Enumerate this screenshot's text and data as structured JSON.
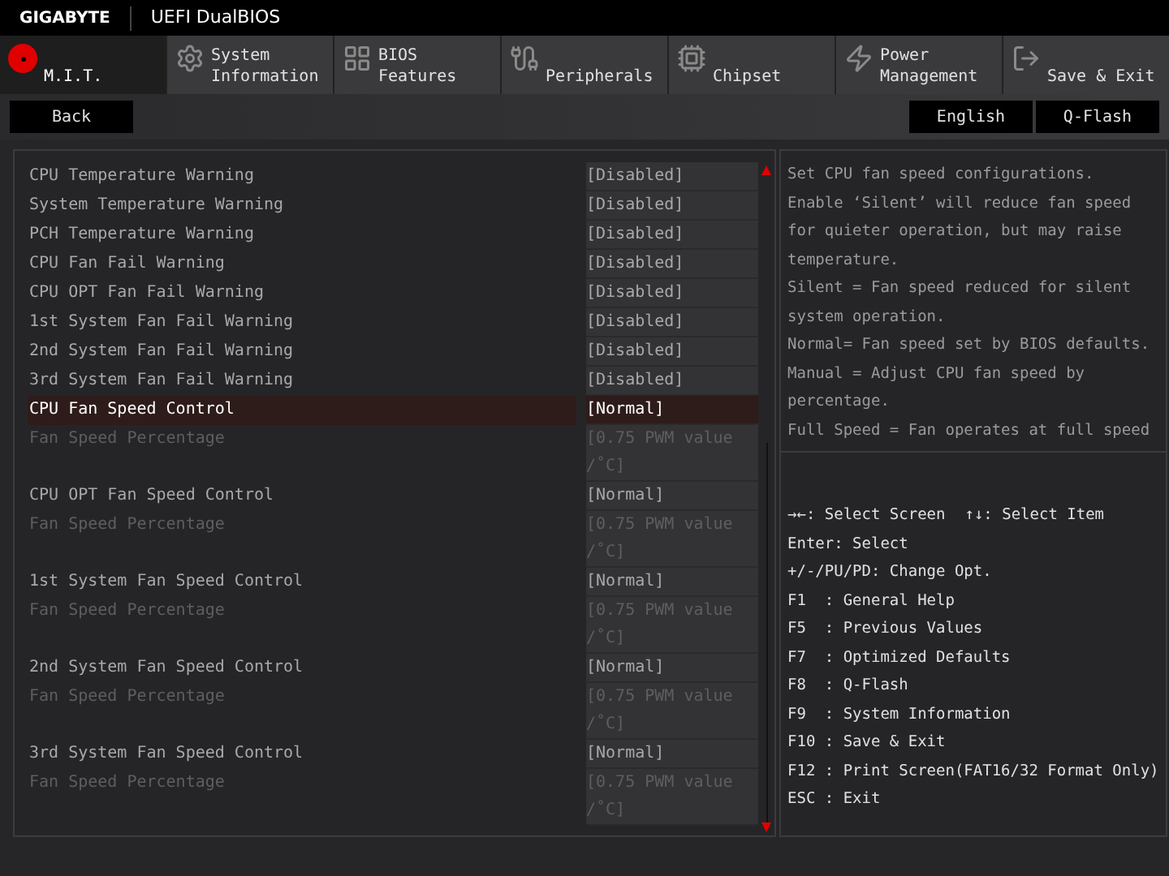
{
  "header": {
    "brand": "GIGABYTE",
    "title": "UEFI DualBIOS"
  },
  "tabs": [
    {
      "label": "M.I.T.",
      "selected": true
    },
    {
      "label": "System Information",
      "selected": false
    },
    {
      "label": "BIOS Features",
      "selected": false
    },
    {
      "label": "Peripherals",
      "selected": false
    },
    {
      "label": "Chipset",
      "selected": false
    },
    {
      "label": "Power Management",
      "selected": false
    },
    {
      "label": "Save & Exit",
      "selected": false
    }
  ],
  "toolbar": {
    "back": "Back",
    "language": "English",
    "qflash": "Q-Flash"
  },
  "settings": [
    {
      "label": "CPU Temperature Warning",
      "value": "[Disabled]",
      "selected": false,
      "disabled": false
    },
    {
      "label": "System Temperature Warning",
      "value": "[Disabled]",
      "selected": false,
      "disabled": false
    },
    {
      "label": "PCH Temperature Warning",
      "value": "[Disabled]",
      "selected": false,
      "disabled": false
    },
    {
      "label": "CPU Fan Fail Warning",
      "value": "[Disabled]",
      "selected": false,
      "disabled": false
    },
    {
      "label": "CPU OPT Fan Fail Warning",
      "value": "[Disabled]",
      "selected": false,
      "disabled": false
    },
    {
      "label": "1st System Fan Fail Warning",
      "value": "[Disabled]",
      "selected": false,
      "disabled": false
    },
    {
      "label": "2nd System Fan Fail Warning",
      "value": "[Disabled]",
      "selected": false,
      "disabled": false
    },
    {
      "label": "3rd System Fan Fail Warning",
      "value": "[Disabled]",
      "selected": false,
      "disabled": false
    },
    {
      "label": "CPU Fan Speed Control",
      "value": "[Normal]",
      "selected": true,
      "disabled": false
    },
    {
      "label": "Fan Speed Percentage",
      "value": "[0.75 PWM value /˚C]",
      "selected": false,
      "disabled": true
    },
    {
      "label": "CPU OPT Fan Speed Control",
      "value": "[Normal]",
      "selected": false,
      "disabled": false
    },
    {
      "label": "Fan Speed Percentage",
      "value": "[0.75 PWM value /˚C]",
      "selected": false,
      "disabled": true
    },
    {
      "label": "1st System Fan Speed Control",
      "value": "[Normal]",
      "selected": false,
      "disabled": false
    },
    {
      "label": "Fan Speed Percentage",
      "value": "[0.75 PWM value /˚C]",
      "selected": false,
      "disabled": true
    },
    {
      "label": "2nd System Fan Speed Control",
      "value": "[Normal]",
      "selected": false,
      "disabled": false
    },
    {
      "label": "Fan Speed Percentage",
      "value": "[0.75 PWM value /˚C]",
      "selected": false,
      "disabled": true
    },
    {
      "label": "3rd System Fan Speed Control",
      "value": "[Normal]",
      "selected": false,
      "disabled": false
    },
    {
      "label": "Fan Speed Percentage",
      "value": "[0.75 PWM value /˚C]",
      "selected": false,
      "disabled": true
    }
  ],
  "help": [
    "Set CPU fan speed configurations.",
    "Enable ‘Silent’ will reduce fan speed for quieter operation, but may raise temperature.",
    "Silent = Fan speed reduced for silent system operation.",
    "Normal= Fan speed set by BIOS defaults.",
    "Manual = Adjust CPU fan speed by percentage.",
    "Full Speed = Fan operates at full speed"
  ],
  "key_legend": [
    [
      "→←: Select Screen",
      "↑↓: Select Item"
    ],
    [
      "Enter: Select"
    ],
    [
      "+/-/PU/PD: Change Opt."
    ],
    [
      "F1  : General Help"
    ],
    [
      "F5  : Previous Values"
    ],
    [
      "F7  : Optimized Defaults"
    ],
    [
      "F8  : Q-Flash"
    ],
    [
      "F9  : System Information"
    ],
    [
      "F10 : Save & Exit"
    ],
    [
      "F12 : Print Screen(FAT16/32 Format Only)"
    ],
    [
      "ESC : Exit"
    ]
  ]
}
